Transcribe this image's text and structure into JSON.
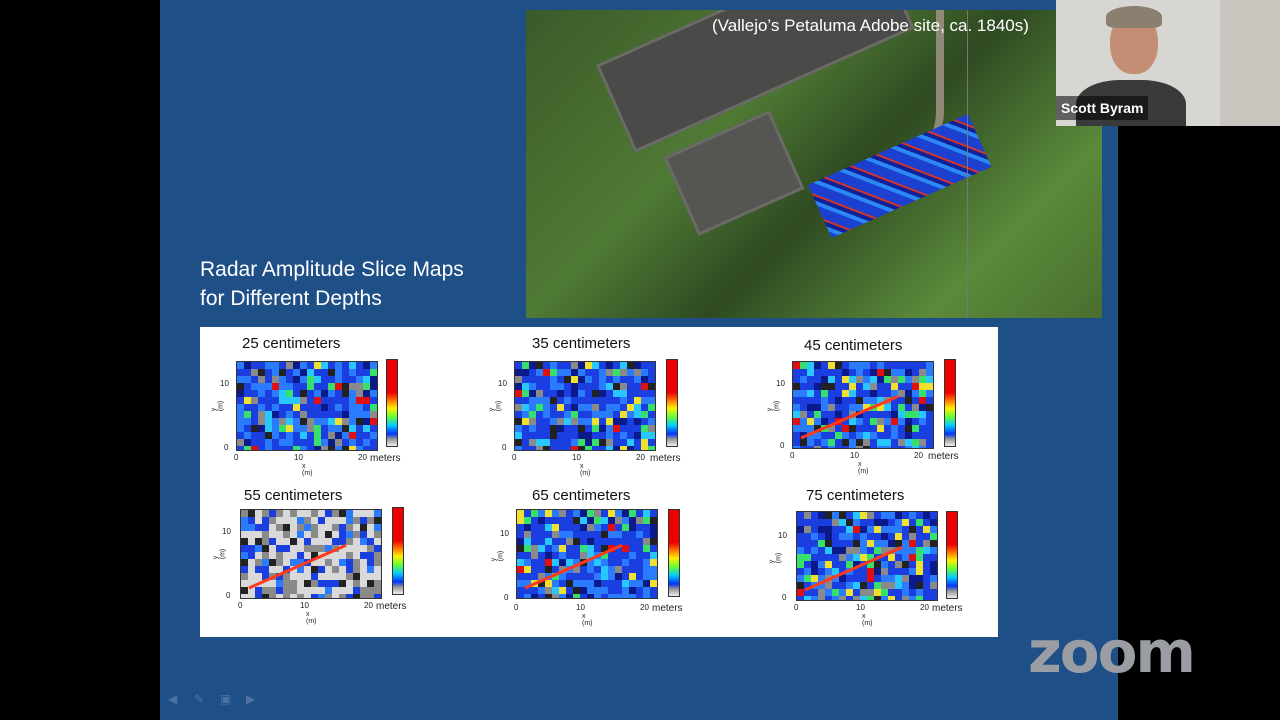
{
  "slide": {
    "caption": "(Vallejo’s  Petaluma Adobe site, ca. 1840s)",
    "title_line1": "Radar Amplitude Slice Maps",
    "title_line2": "for Different Depths",
    "slices": [
      {
        "label": "25 centimeters",
        "units": "meters",
        "y_axis": "y (m)",
        "x_axis": "x (m)",
        "x_ticks": [
          "0",
          "10",
          "20"
        ],
        "y_ticks": [
          "0",
          "10"
        ]
      },
      {
        "label": "35 centimeters",
        "units": "meters",
        "y_axis": "y (m)",
        "x_axis": "x (m)",
        "x_ticks": [
          "0",
          "10",
          "20"
        ],
        "y_ticks": [
          "0",
          "10"
        ]
      },
      {
        "label": "45 centimeters",
        "units": "meters",
        "y_axis": "y (m)",
        "x_axis": "x (m)",
        "x_ticks": [
          "0",
          "10",
          "20"
        ],
        "y_ticks": [
          "0",
          "10"
        ]
      },
      {
        "label": "55 centimeters",
        "units": "meters",
        "y_axis": "y (m)",
        "x_axis": "x (m)",
        "x_ticks": [
          "0",
          "10",
          "20"
        ],
        "y_ticks": [
          "0",
          "10"
        ]
      },
      {
        "label": "65 centimeters",
        "units": "meters",
        "y_axis": "y (m)",
        "x_axis": "x (m)",
        "x_ticks": [
          "0",
          "10",
          "20"
        ],
        "y_ticks": [
          "0",
          "10"
        ]
      },
      {
        "label": "75 centimeters",
        "units": "meters",
        "y_axis": "y (m)",
        "x_axis": "x (m)",
        "x_ticks": [
          "0",
          "10",
          "20"
        ],
        "y_ticks": [
          "0",
          "10"
        ]
      }
    ]
  },
  "video": {
    "participant_name": "Scott Byram"
  },
  "branding": {
    "logo_text": "zoom",
    "logo_color": "#9a9da3"
  },
  "nav_icons": [
    "prev-arrow-icon",
    "pen-icon",
    "slides-icon",
    "next-arrow-icon"
  ]
}
